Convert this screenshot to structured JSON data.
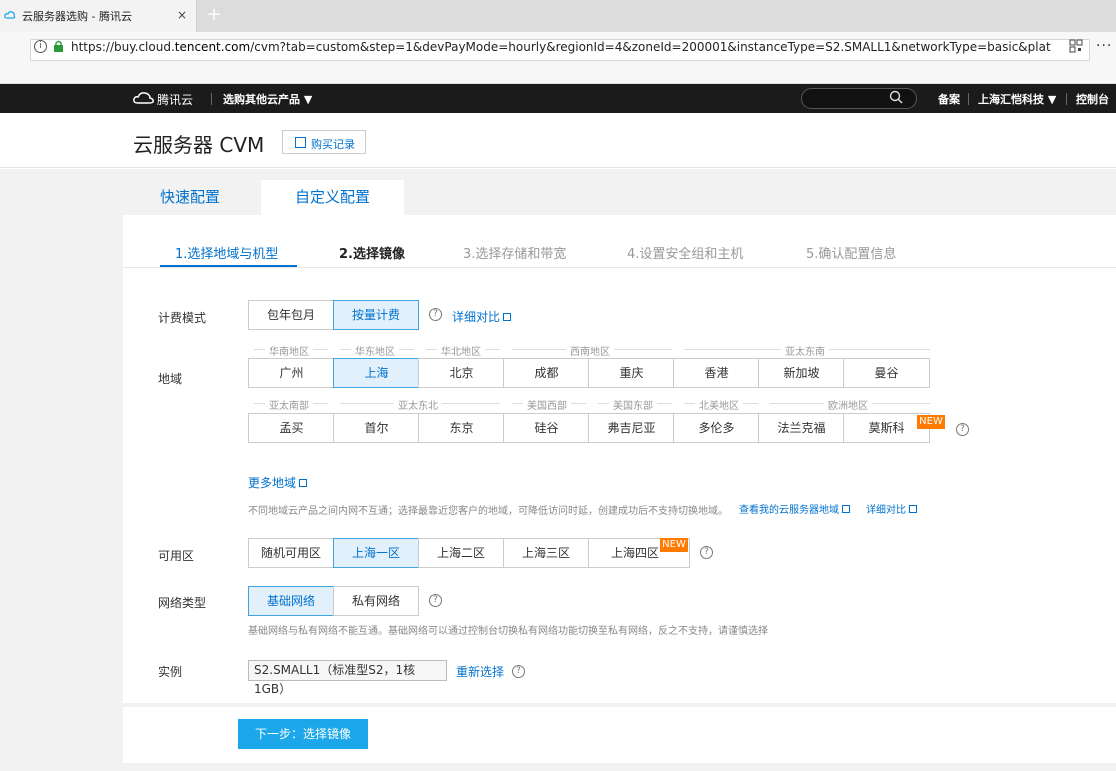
{
  "browser": {
    "tab_title": "云服务器选购 - 腾讯云",
    "close_glyph": "×",
    "new_tab_glyph": "+",
    "url_prefix": "https://buy.cloud.",
    "url_domain": "tencent.com",
    "url_rest": "/cvm?tab=custom&step=1&devPayMode=hourly&regionId=4&zoneId=200001&instanceType=S2.SMALL1&networkType=basic&platform=Ce",
    "more_glyph": "···"
  },
  "topnav": {
    "logo_text": "腾讯云",
    "products_label": "选购其他云产品 ▼",
    "beian_label": "备案",
    "company_label": "上海汇恺科技 ▼",
    "console_label": "控制台"
  },
  "header": {
    "title": "云服务器 CVM",
    "purchase_record_label": "购买记录"
  },
  "config_tabs": [
    "快速配置",
    "自定义配置"
  ],
  "steps": [
    "1.选择地域与机型",
    "2.选择镜像",
    "3.选择存储和带宽",
    "4.设置安全组和主机",
    "5.确认配置信息"
  ],
  "billing": {
    "label": "计费模式",
    "options": [
      "包年包月",
      "按量计费"
    ],
    "selected": "按量计费",
    "compare_link": "详细对比"
  },
  "region": {
    "label": "地域",
    "group_row1": [
      "华南地区",
      "华东地区",
      "华北地区",
      "西南地区",
      "亚太东南"
    ],
    "cities_row1": [
      "广州",
      "上海",
      "北京",
      "成都",
      "重庆",
      "香港",
      "新加坡",
      "曼谷"
    ],
    "group_row2": [
      "亚太南部",
      "亚太东北",
      "美国西部",
      "美国东部",
      "北美地区",
      "欧洲地区"
    ],
    "cities_row2": [
      "孟买",
      "首尔",
      "东京",
      "硅谷",
      "弗吉尼亚",
      "多伦多",
      "法兰克福",
      "莫斯科"
    ],
    "selected": "上海",
    "new_badge": "NEW",
    "more_link": "更多地域",
    "note": "不同地域云产品之间内网不互通；选择最靠近您客户的地域，可降低访问时延，创建成功后不支持切换地域。",
    "my_regions_link": "查看我的云服务器地域",
    "compare_link": "详细对比"
  },
  "zone": {
    "label": "可用区",
    "options": [
      "随机可用区",
      "上海一区",
      "上海二区",
      "上海三区",
      "上海四区"
    ],
    "selected": "上海一区",
    "new_badge": "NEW"
  },
  "network": {
    "label": "网络类型",
    "options": [
      "基础网络",
      "私有网络"
    ],
    "selected": "基础网络",
    "note": "基础网络与私有网络不能互通。基础网络可以通过控制台切换私有网络功能切换至私有网络，反之不支持，请谨慎选择"
  },
  "instance": {
    "label": "实例",
    "value": "S2.SMALL1（标准型S2，1核1GB）",
    "reselect_link": "重新选择"
  },
  "footer": {
    "next_label": "下一步：选择镜像"
  },
  "glyphs": {
    "help": "?",
    "info": "i"
  },
  "colors": {
    "accent": "#0071ce",
    "selected_bg": "#e1f0fb",
    "primary_btn": "#1ba7ea",
    "new_badge": "#ff7a00",
    "topnav_bg": "#1b1b1b"
  }
}
